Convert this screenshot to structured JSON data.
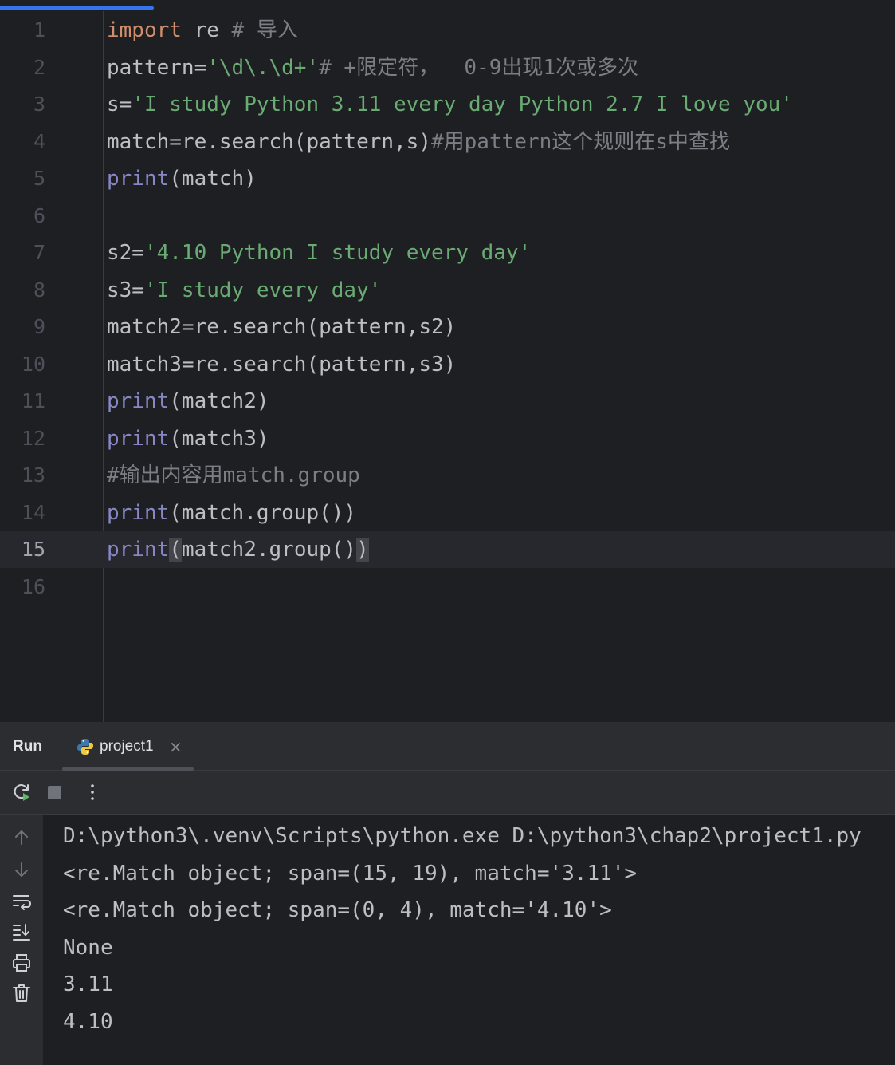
{
  "editor": {
    "lines": [
      {
        "n": "1",
        "tokens": [
          {
            "t": "import",
            "c": "kw"
          },
          {
            "t": " re ",
            "c": ""
          },
          {
            "t": "# 导入",
            "c": "cmt"
          }
        ]
      },
      {
        "n": "2",
        "tokens": [
          {
            "t": "pattern=",
            "c": ""
          },
          {
            "t": "'\\d\\.\\d+'",
            "c": "str"
          },
          {
            "t": "# +限定符，  0-9出现1次或多次",
            "c": "cmt"
          }
        ]
      },
      {
        "n": "3",
        "tokens": [
          {
            "t": "s=",
            "c": ""
          },
          {
            "t": "'I study Python 3.11 every day Python 2.7 I love you'",
            "c": "str"
          }
        ]
      },
      {
        "n": "4",
        "tokens": [
          {
            "t": "match=re.search(pattern,s)",
            "c": ""
          },
          {
            "t": "#用pattern这个规则在s中查找",
            "c": "cmt"
          }
        ]
      },
      {
        "n": "5",
        "tokens": [
          {
            "t": "print",
            "c": "bi"
          },
          {
            "t": "(match)",
            "c": ""
          }
        ]
      },
      {
        "n": "6",
        "tokens": []
      },
      {
        "n": "7",
        "tokens": [
          {
            "t": "s2=",
            "c": ""
          },
          {
            "t": "'4.10 Python I study every day'",
            "c": "str"
          }
        ]
      },
      {
        "n": "8",
        "tokens": [
          {
            "t": "s3=",
            "c": ""
          },
          {
            "t": "'I study every day'",
            "c": "str"
          }
        ]
      },
      {
        "n": "9",
        "tokens": [
          {
            "t": "match2=re.search(pattern,s2)",
            "c": ""
          }
        ]
      },
      {
        "n": "10",
        "tokens": [
          {
            "t": "match3=re.search(pattern,s3)",
            "c": ""
          }
        ]
      },
      {
        "n": "11",
        "tokens": [
          {
            "t": "print",
            "c": "bi"
          },
          {
            "t": "(match2)",
            "c": ""
          }
        ]
      },
      {
        "n": "12",
        "tokens": [
          {
            "t": "print",
            "c": "bi"
          },
          {
            "t": "(match3)",
            "c": ""
          }
        ]
      },
      {
        "n": "13",
        "tokens": [
          {
            "t": "#输出内容用match.group",
            "c": "cmt"
          }
        ]
      },
      {
        "n": "14",
        "tokens": [
          {
            "t": "print",
            "c": "bi"
          },
          {
            "t": "(match.group())",
            "c": ""
          }
        ]
      },
      {
        "n": "15",
        "current": true,
        "tokens": [
          {
            "t": "print",
            "c": "bi"
          },
          {
            "t": "(",
            "c": "brace-hl"
          },
          {
            "t": "match2.group()",
            "c": ""
          },
          {
            "t": ")",
            "c": "brace-hl"
          }
        ]
      },
      {
        "n": "16",
        "tokens": []
      }
    ]
  },
  "run_panel": {
    "title": "Run",
    "tab_label": "project1",
    "tab_close": "×",
    "output": [
      "D:\\python3\\.venv\\Scripts\\python.exe D:\\python3\\chap2\\project1.py",
      "<re.Match object; span=(15, 19), match='3.11'>",
      "<re.Match object; span=(0, 4), match='4.10'>",
      "None",
      "3.11",
      "4.10"
    ]
  },
  "colors": {
    "keyword": "#cf8e6d",
    "string": "#6aab73",
    "comment": "#7a7e85",
    "builtin": "#8888c6",
    "text": "#bcbec4",
    "accent": "#3574f0"
  },
  "icons": {
    "run_toolbar": [
      "rerun-icon",
      "stop-icon",
      "more-options-icon"
    ],
    "side_toolbar": [
      "scroll-up-icon",
      "scroll-down-icon",
      "soft-wrap-icon",
      "scroll-to-end-icon",
      "print-icon",
      "clear-all-icon"
    ],
    "tab": "python-file-icon"
  }
}
